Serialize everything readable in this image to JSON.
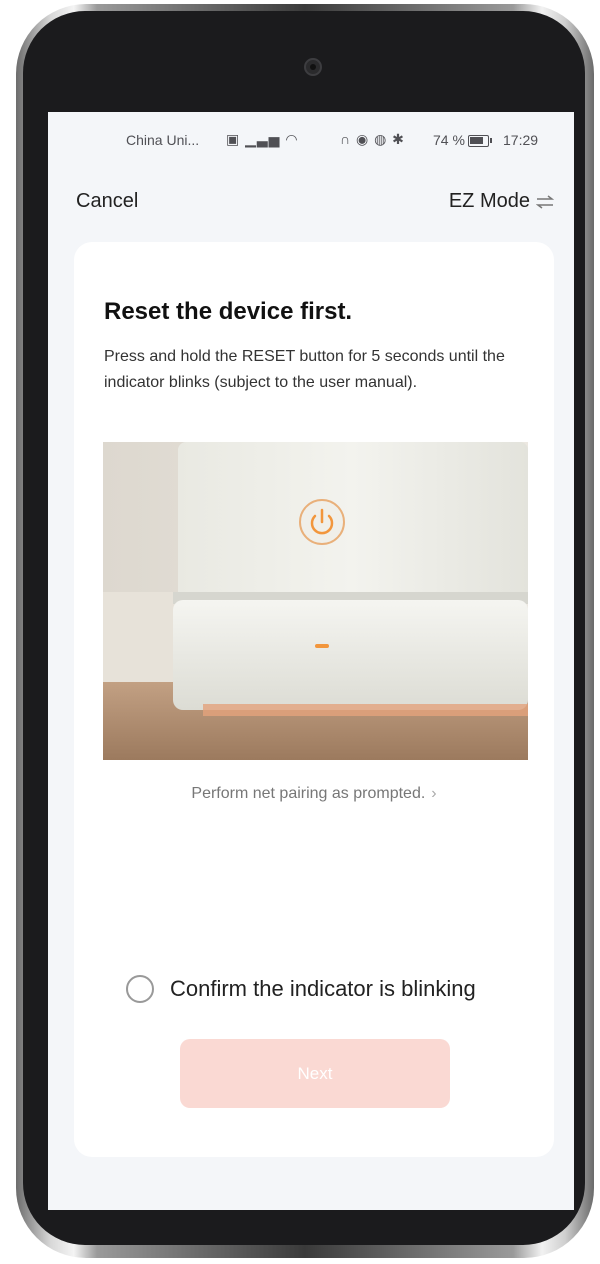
{
  "status_bar": {
    "carrier": "China Uni...",
    "battery_percent": "74 %",
    "battery_level": 0.74,
    "time": "17:29"
  },
  "nav": {
    "cancel_label": "Cancel",
    "mode_label": "EZ Mode"
  },
  "card": {
    "title": "Reset the device first.",
    "description": "Press and hold the RESET button for 5 seconds until the indicator blinks (subject to the user manual).",
    "pairing_link": "Perform net pairing as prompted.",
    "confirm_label": "Confirm the indicator is blinking",
    "next_label": "Next"
  },
  "colors": {
    "next_button_disabled": "#fad9d3",
    "indicator_orange": "#f2963c",
    "screen_bg": "#f4f6f9"
  }
}
